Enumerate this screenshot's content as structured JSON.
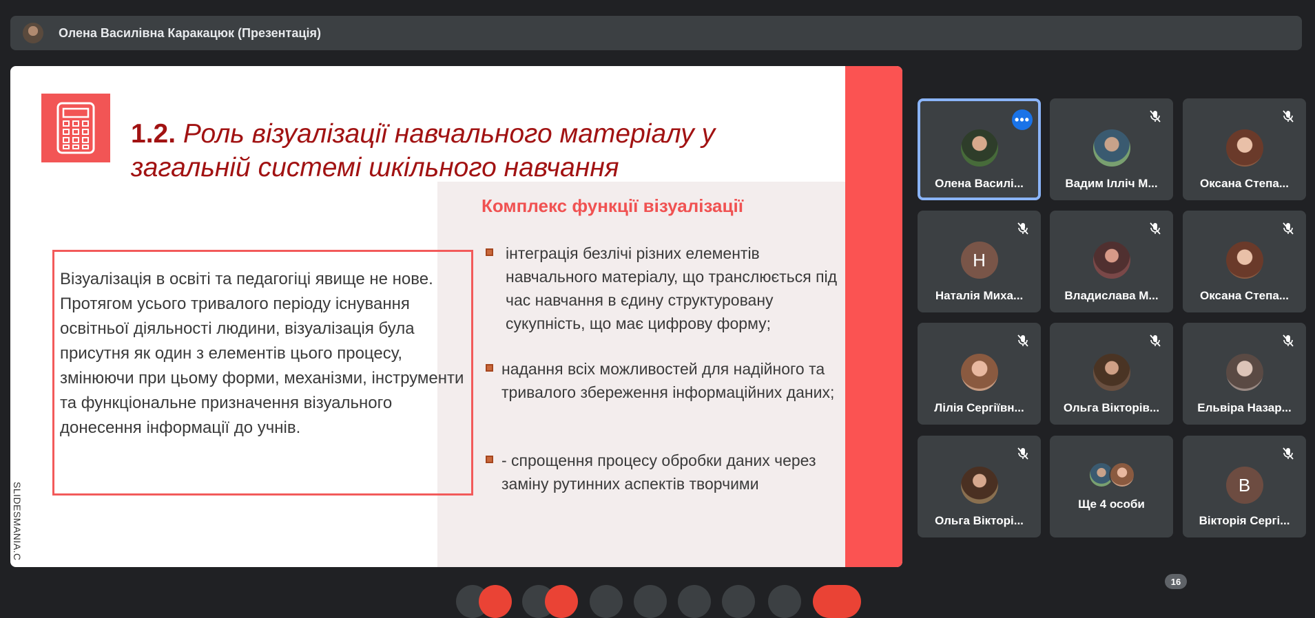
{
  "header": {
    "presenter_title": "Олена Василівна Каракацюк (Презентація)"
  },
  "slide": {
    "title_number": "1.2.",
    "title_text": "Роль візуалізації навчального матеріалу у загальній системі шкільного навчання",
    "side_heading": "Комплекс функції візуалізації",
    "body_text": "Візуалізація в освіті та педагогіці явище не нове. Протягом усього тривалого періоду існування освітньої діяльності людини, візуалізація була присутня як один з елементів цього процесу, змінюючи при цьому форми, механізми, інструменти та функціональне призначення візуального донесення інформації до учнів.",
    "bullets": [
      "інтеграція безлічі різних елементів навчального матеріалу, що транслюється під час навчання в єдину структуровану сукупність, що має цифрову форму;",
      "надання всіх можливостей для надійного та тривалого збереження інформаційних даних;",
      "-   спрощення процесу обробки даних через заміну рутинних аспектів творчими"
    ],
    "watermark": "SLIDESMANIA.C",
    "colors": {
      "accent_red": "#fb5352",
      "title_red": "#a11212",
      "panel_pink": "#f3eded"
    }
  },
  "participants": [
    {
      "name": "Олена Василі...",
      "active": true
    },
    {
      "name": "Вадим Ілліч М...",
      "muted": true
    },
    {
      "name": "Оксана Степа...",
      "muted": true
    },
    {
      "name": "Наталія Миха...",
      "initial": "Н",
      "muted": true
    },
    {
      "name": "Владислава М...",
      "muted": true
    },
    {
      "name": "Оксана Степа...",
      "muted": true
    },
    {
      "name": "Лілія Сергіївн...",
      "muted": true
    },
    {
      "name": "Ольга Вікторів...",
      "muted": true
    },
    {
      "name": "Ельвіра Назар...",
      "muted": true
    },
    {
      "name": "Ольга Вікторі...",
      "muted": true
    },
    {
      "name": "Ще 4 особи"
    },
    {
      "name": "Вікторія Сергі...",
      "initial": "B",
      "muted": true
    }
  ],
  "bottom": {
    "participant_count": "16"
  },
  "icons": [
    "calculator-icon",
    "mic-off-icon",
    "more-options-icon"
  ]
}
